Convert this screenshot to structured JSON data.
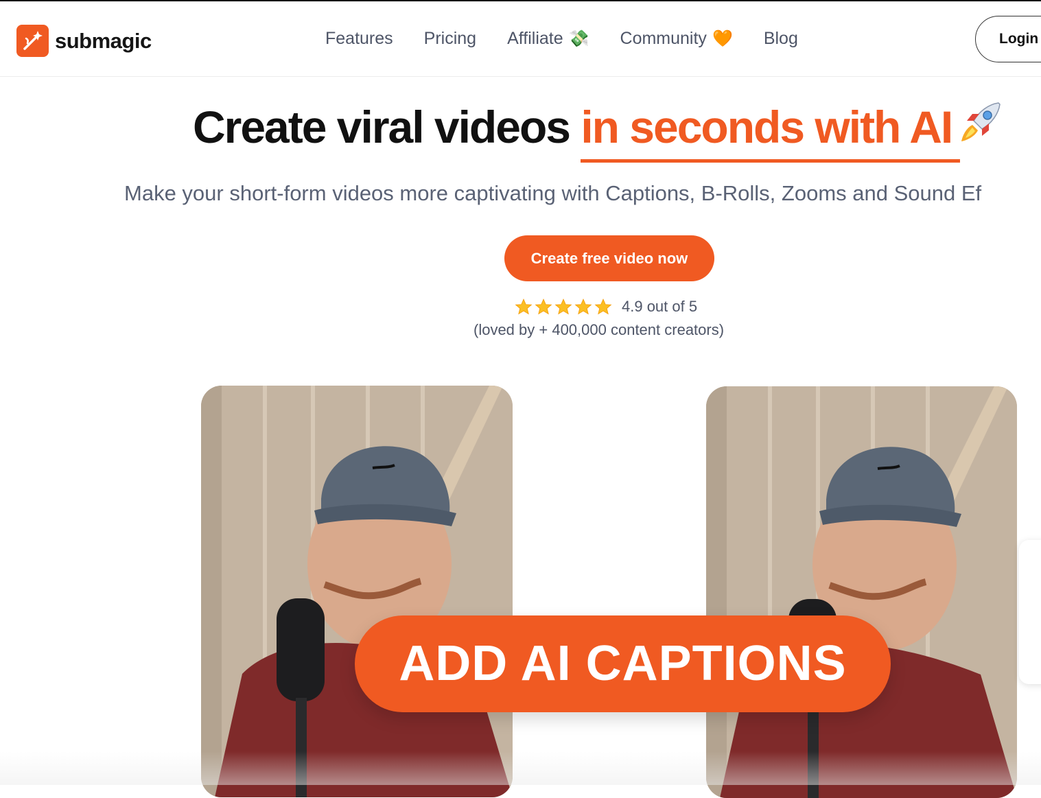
{
  "brand": {
    "name": "submagic",
    "color": "#f05a22"
  },
  "nav": {
    "items": [
      {
        "label": "Features",
        "emoji": ""
      },
      {
        "label": "Pricing",
        "emoji": ""
      },
      {
        "label": "Affiliate",
        "emoji": "💸"
      },
      {
        "label": "Community",
        "emoji": "🧡"
      },
      {
        "label": "Blog",
        "emoji": ""
      }
    ],
    "login_label": "Login"
  },
  "hero": {
    "title_plain": "Create viral videos ",
    "title_accent": "in seconds with AI",
    "subtitle": "Make your short-form videos more captivating with Captions, B-Rolls, Zooms and Sound Ef",
    "cta_label": "Create free video now",
    "rating_text": "4.9 out of 5",
    "rating_value": 4.9,
    "rating_max": 5,
    "loved_text": "(loved by + 400,000 content creators)"
  },
  "demo": {
    "caption": "ADD AI CAPTIONS"
  }
}
